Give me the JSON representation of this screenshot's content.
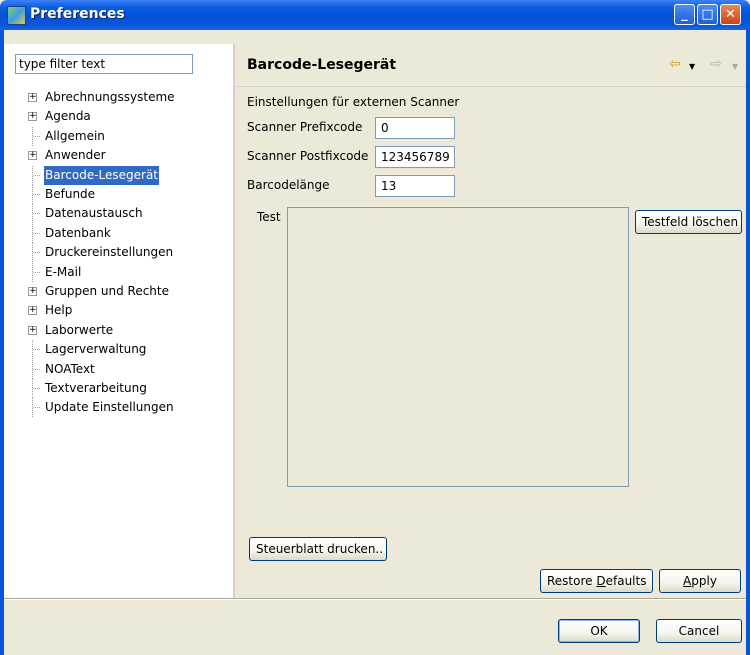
{
  "window": {
    "title": "Preferences",
    "minimize_symbol": "_",
    "maximize_symbol": "□",
    "close_symbol": "✕"
  },
  "filter": {
    "value": "type filter text"
  },
  "tree": {
    "items": [
      {
        "label": "Abrechnungssysteme",
        "expandable": true
      },
      {
        "label": "Agenda",
        "expandable": true
      },
      {
        "label": "Allgemein",
        "expandable": false
      },
      {
        "label": "Anwender",
        "expandable": true
      },
      {
        "label": "Barcode-Lesegerät",
        "expandable": false,
        "selected": true
      },
      {
        "label": "Befunde",
        "expandable": false
      },
      {
        "label": "Datenaustausch",
        "expandable": false
      },
      {
        "label": "Datenbank",
        "expandable": false
      },
      {
        "label": "Druckereinstellungen",
        "expandable": false
      },
      {
        "label": "E-Mail",
        "expandable": false
      },
      {
        "label": "Gruppen und Rechte",
        "expandable": true
      },
      {
        "label": "Help",
        "expandable": true
      },
      {
        "label": "Laborwerte",
        "expandable": true
      },
      {
        "label": "Lagerverwaltung",
        "expandable": false
      },
      {
        "label": "NOAText",
        "expandable": false
      },
      {
        "label": "Textverarbeitung",
        "expandable": false
      },
      {
        "label": "Update Einstellungen",
        "expandable": false
      }
    ],
    "expander_symbol": "+"
  },
  "page": {
    "title": "Barcode-Lesegerät",
    "nav_back": "⇦",
    "nav_forward": "⇨",
    "dropdown_symbol": "▼",
    "section_label": "Einstellungen für externen Scanner",
    "prefix_label": "Scanner Prefixcode",
    "prefix_value": "0",
    "postfix_label": "Scanner Postfixcode",
    "postfix_value": "123456789",
    "length_label": "Barcodelänge",
    "length_value": "13",
    "test_label": "Test",
    "clear_button": "Testfeld löschen",
    "print_button": "Steuerblatt drucken.."
  },
  "buttons": {
    "restore_pre": "Restore ",
    "restore_mnemonic": "D",
    "restore_post": "efaults",
    "apply_mnemonic": "A",
    "apply_post": "pply",
    "ok": "OK",
    "cancel": "Cancel"
  },
  "colors": {
    "titlebar": "#0A54DA",
    "selection": "#316AC5",
    "dialog_bg": "#ECE9D8"
  }
}
